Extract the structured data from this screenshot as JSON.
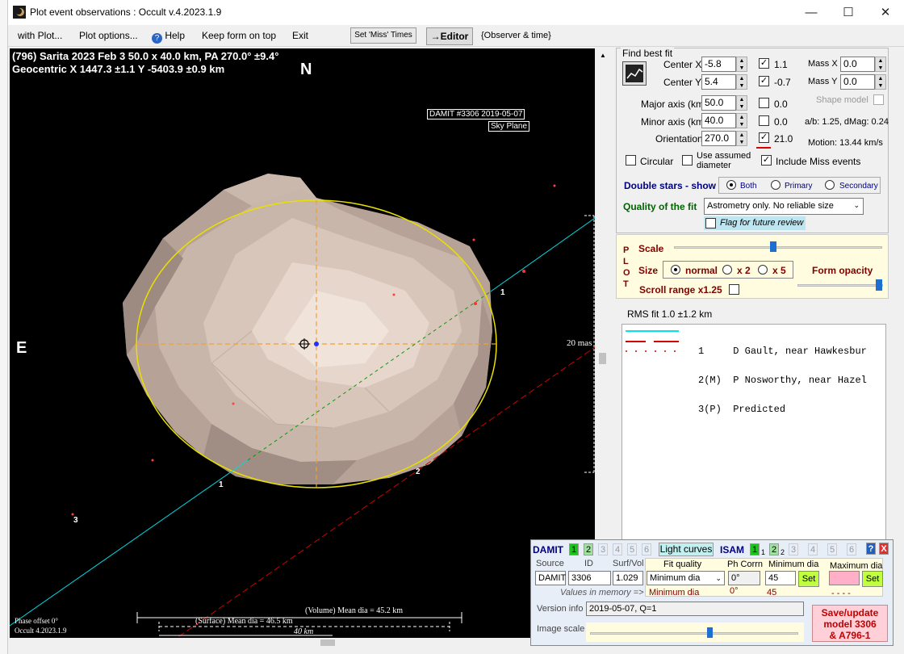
{
  "window": {
    "title": "Plot event observations : Occult v.4.2023.1.9",
    "minimize": "—",
    "maximize": "☐",
    "close": "✕"
  },
  "menu": {
    "with_plot": "with Plot...",
    "plot_options": "Plot options...",
    "help": "Help",
    "keep_on_top": "Keep form on top",
    "exit": "Exit",
    "set_miss_times": "Set 'Miss' Times",
    "editor": "→Editor",
    "observer_time": "{Observer & time}"
  },
  "plot": {
    "header_line1": "(796) Sarita  2023 Feb 3   50.0 x 40.0 km,  PA 270.0° ±9.4°",
    "header_line2": "Geocentric  X  1447.3 ±1.1  Y -5403.9 ±0.9 km",
    "north": "N",
    "east": "E",
    "damit_label1": "DAMIT #3306 2019-05-07",
    "damit_label2": "Sky Plane",
    "scale_mas": "20 mas",
    "chord_labels": [
      "1",
      "1",
      "2",
      "3"
    ],
    "phase_offset": "Phase offset 0°",
    "version_note": "Occult 4.2023.1.9",
    "volume_dia": "(Volume) Mean dia = 45.2 km",
    "surface_dia": "(Surface) Mean dia = 46.5 km",
    "scalebar": "40 km"
  },
  "fit": {
    "heading": "Find best fit",
    "center_x_label": "Center X",
    "center_x": "-5.8",
    "center_y_label": "Center Y",
    "center_y": "5.4",
    "major_label": "Major axis (km)",
    "major": "50.0",
    "minor_label": "Minor axis (km)",
    "minor": "40.0",
    "orient_label": "Orientation",
    "orient": "270.0",
    "cx_val": "1.1",
    "cy_val": "-0.7",
    "major_val": "0.0",
    "minor_val": "0.0",
    "orient_val": "21.0",
    "mass_x_label": "Mass X",
    "mass_x": "0.0",
    "mass_y_label": "Mass Y",
    "mass_y": "0.0",
    "shape_model": "Shape model",
    "ab_ratio": "a/b: 1.25, dMag: 0.24",
    "motion": "Motion: 13.44 km/s",
    "circular": "Circular",
    "use_assumed_1": "Use assumed",
    "use_assumed_2": "diameter",
    "include_miss": "Include Miss events",
    "double_stars": "Double stars - show",
    "ds_both": "Both",
    "ds_primary": "Primary",
    "ds_secondary": "Secondary",
    "quality_label": "Quality of the fit",
    "quality_value": "Astrometry only. No reliable size",
    "flag_review": "Flag for future review"
  },
  "plotpanel": {
    "plot_letters": "P L O T",
    "scale": "Scale",
    "size": "Size",
    "size_normal": "normal",
    "size_x2": "x 2",
    "size_x5": "x 5",
    "form_opacity": "Form opacity",
    "scroll_range": "Scroll range x1.25",
    "rms": "RMS fit  1.0 ±1.2 km"
  },
  "legend": [
    {
      "num": "1",
      "code": "",
      "text": "D Gault, near Hawkesbur",
      "color": "#00e5ee",
      "style": "solid"
    },
    {
      "num": "2",
      "code": "(M)",
      "text": "P Nosworthy, near Hazel",
      "color": "#d00000",
      "style": "dashed"
    },
    {
      "num": "3",
      "code": "(P)",
      "text": "Predicted",
      "color": "#e04040",
      "style": "dotted"
    }
  ],
  "damit": {
    "damit": "DAMIT",
    "tabs": [
      "1",
      "2",
      "3",
      "4",
      "5",
      "6"
    ],
    "light_curves": "Light curves",
    "isam": "ISAM",
    "isam_tabs": [
      "1",
      "1",
      "2",
      "2",
      "3",
      "4",
      "5",
      "6"
    ],
    "help_q": "?",
    "close_x": "X",
    "source_lbl": "Source",
    "id_lbl": "ID",
    "surf_lbl": "Surf/Vol",
    "fit_quality_lbl": "Fit quality",
    "ph_corr_lbl": "Ph Corrn",
    "min_dia_lbl": "Minimum dia",
    "max_dia_lbl": "Maximum dia",
    "source": "DAMIT",
    "id": "3306",
    "surf": "1.029",
    "fit_quality": "Minimum dia",
    "ph_corr": "0°",
    "min_dia": "45",
    "set1": "Set",
    "set2": "Set",
    "values_in_memory": "Values in memory =>",
    "mem_fit": "Minimum dia",
    "mem_ph": "0°",
    "mem_min": "45",
    "mem_max": "- - - -",
    "version_lbl": "Version info",
    "version": "2019-05-07, Q=1",
    "image_scale": "Image scale",
    "save1": "Save/update",
    "save2": "model 3306",
    "save3": "& A796-1"
  }
}
